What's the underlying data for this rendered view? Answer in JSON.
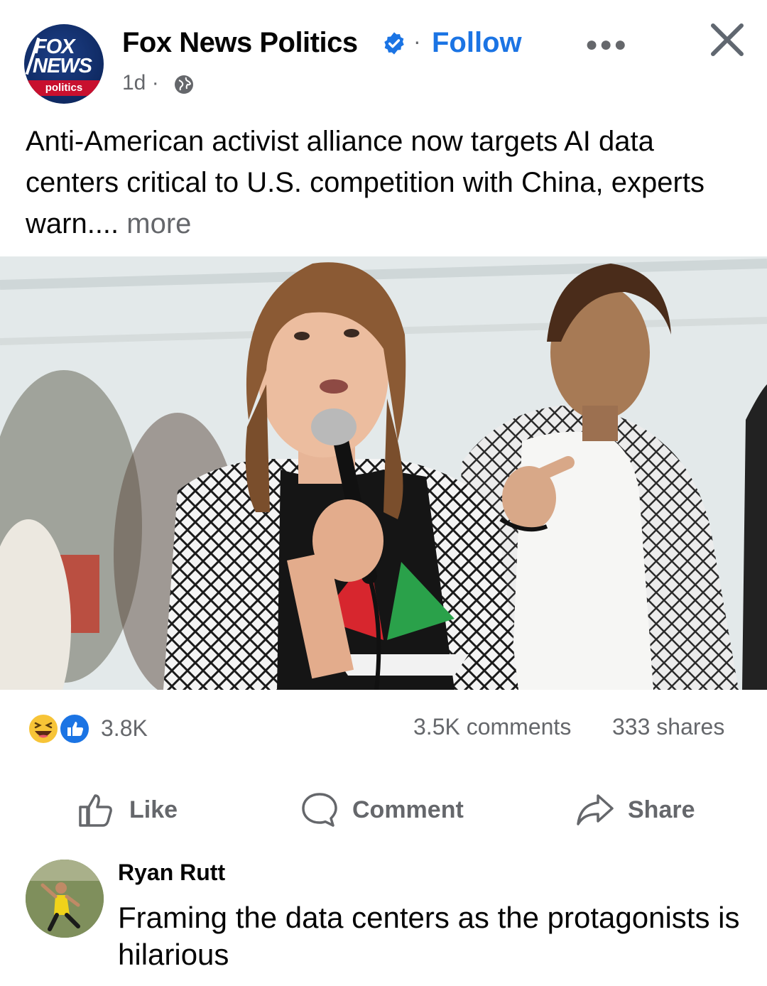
{
  "post": {
    "page_name": "Fox News Politics",
    "follow_label": "Follow",
    "separator": "·",
    "time": "1d ·",
    "logo_text_1": "FOX",
    "logo_text_2": "NEWS",
    "logo_text_3": "politics",
    "caption": "Anti-American activist alliance now targets AI data centers critical to U.S. competition with China, experts warn....",
    "more_label": "more"
  },
  "stats": {
    "reactions": "3.8K",
    "comments": "3.5K comments",
    "shares": "333 shares"
  },
  "actions": {
    "like": "Like",
    "comment": "Comment",
    "share": "Share"
  },
  "comment": {
    "author": "Ryan Rutt",
    "text": "Framing the data centers as the protagonists is hilarious"
  },
  "colors": {
    "link_blue": "#1b74e4",
    "muted": "#65676b",
    "fox_red": "#c8102e",
    "fox_navy": "#0f2a63"
  },
  "icons": [
    "verified-badge-icon",
    "more-options-icon",
    "close-icon",
    "globe-icon",
    "haha-reaction-icon",
    "like-reaction-icon",
    "like-thumb-icon",
    "comment-bubble-icon",
    "share-arrow-icon"
  ]
}
